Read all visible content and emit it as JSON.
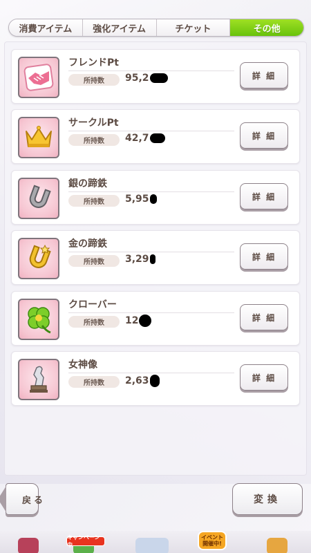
{
  "tabs": [
    {
      "label": "消費アイテム",
      "active": false
    },
    {
      "label": "強化アイテム",
      "active": false
    },
    {
      "label": "チケット",
      "active": false
    },
    {
      "label": "その他",
      "active": true
    }
  ],
  "items": [
    {
      "name": "フレンドPt",
      "own_label": "所持数",
      "value_visible": "95,2",
      "icon": "handshake-icon"
    },
    {
      "name": "サークルPt",
      "own_label": "所持数",
      "value_visible": "42,7",
      "icon": "crown-icon"
    },
    {
      "name": "銀の蹄鉄",
      "own_label": "所持数",
      "value_visible": "5,95",
      "icon": "silver-horseshoe-icon"
    },
    {
      "name": "金の蹄鉄",
      "own_label": "所持数",
      "value_visible": "3,29",
      "icon": "gold-horseshoe-icon"
    },
    {
      "name": "クローバー",
      "own_label": "所持数",
      "value_visible": "12",
      "icon": "clover-icon"
    },
    {
      "name": "女神像",
      "own_label": "所持数",
      "value_visible": "2,63",
      "icon": "goddess-statue-icon"
    }
  ],
  "detail_label": "詳 細",
  "back_label": "戻る",
  "exchange_label": "変換",
  "bottom": {
    "campaign_label": "キャンペーン中",
    "event_label_1": "イベント",
    "event_label_2": "開催中!"
  },
  "colors": {
    "tab_active": "#79cb10",
    "text_brown": "#5d4c44",
    "thumb_pink": "#f6c6d2"
  }
}
